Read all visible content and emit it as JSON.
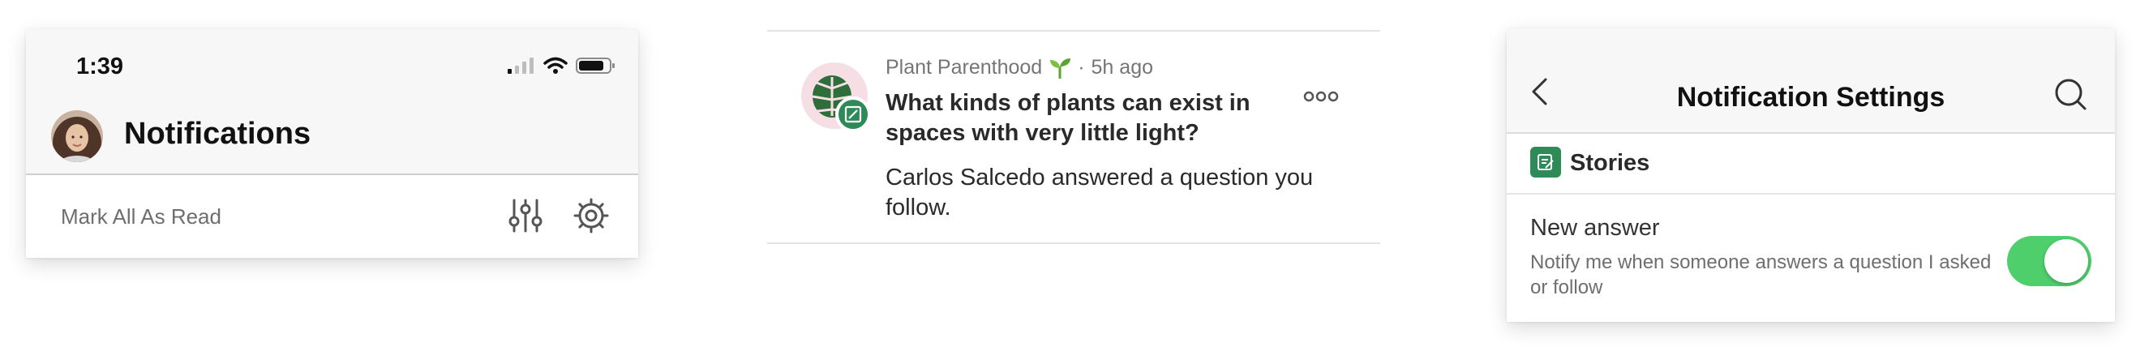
{
  "notifications_panel": {
    "status_time": "1:39",
    "title": "Notifications",
    "mark_all_read": "Mark All As Read",
    "icons": [
      "signal-icon",
      "wifi-icon",
      "battery-icon",
      "avatar",
      "filter-sliders-icon",
      "gear-icon"
    ]
  },
  "notification_item": {
    "space_name": "Plant Parenthood",
    "separator": "·",
    "time_ago": "5h ago",
    "question": "What kinds of plants can exist in spaces with very little light?",
    "message": "Carlos Salcedo answered a question you follow.",
    "icons": [
      "monstera-leaf-icon",
      "seedling-icon",
      "edit-badge-icon",
      "more-icon"
    ]
  },
  "settings_panel": {
    "title": "Notification Settings",
    "section_label": "Stories",
    "setting_title": "New answer",
    "setting_description": "Notify me when someone answers a question I asked or follow",
    "toggle_on": true,
    "icons": [
      "back-chevron-icon",
      "search-icon",
      "stories-icon"
    ]
  },
  "colors": {
    "accent_green": "#2e8b57",
    "toggle_green": "#4fcf6b",
    "logo_background": "#f6dfe4"
  }
}
